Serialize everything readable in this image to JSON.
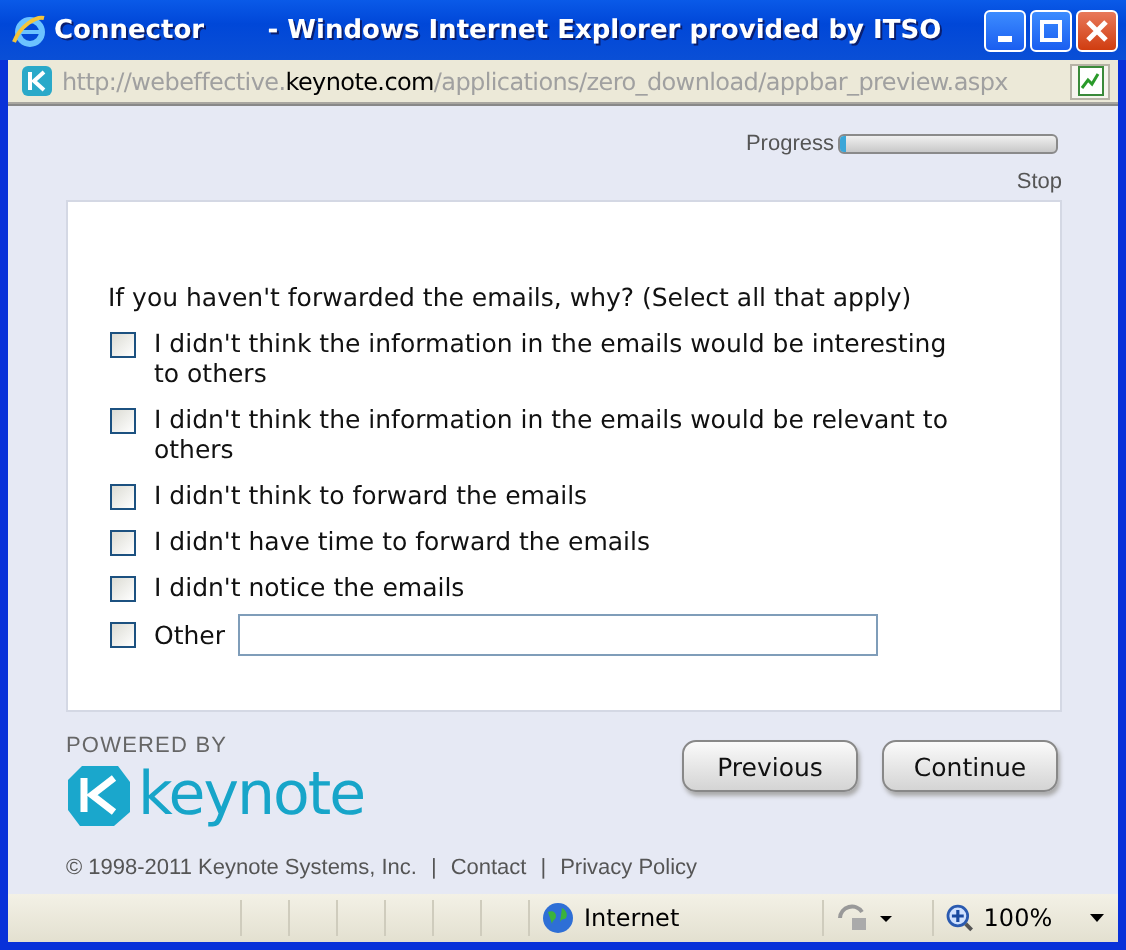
{
  "window": {
    "title": "Connector       - Windows Internet Explorer provided by ITSO"
  },
  "address": {
    "prefix": "http://webeffective.",
    "domain": "keynote.com",
    "path": "/applications/zero_download/appbar_preview.aspx"
  },
  "progress": {
    "label": "Progress",
    "level": 0.03,
    "stop": "Stop"
  },
  "question": "If you haven't forwarded the emails, why? (Select all that apply)",
  "options": [
    {
      "kind": "checkbox",
      "label": "I didn't think the information in the emails would be interesting to others",
      "checked": false
    },
    {
      "kind": "checkbox",
      "label": "I didn't think the information in the emails would be relevant to others",
      "checked": false
    },
    {
      "kind": "checkbox",
      "label": "I didn't think to forward the emails",
      "checked": false
    },
    {
      "kind": "checkbox",
      "label": "I didn't have time to forward the emails",
      "checked": false
    },
    {
      "kind": "checkbox",
      "label": "I didn't notice the emails",
      "checked": false
    },
    {
      "kind": "other",
      "label": "Other",
      "checked": false
    }
  ],
  "branding": {
    "powered_by": "POWERED BY",
    "logo": "keynote"
  },
  "buttons": [
    "Previous",
    "Continue"
  ],
  "footer": {
    "copyright": "© 1998-2011 Keynote Systems, Inc.",
    "separator_1": "|",
    "contact": "Contact",
    "separator_2": "|",
    "privacy": "Privacy Policy"
  },
  "status_bar": {
    "zone": "Internet",
    "zoom": "100%"
  }
}
